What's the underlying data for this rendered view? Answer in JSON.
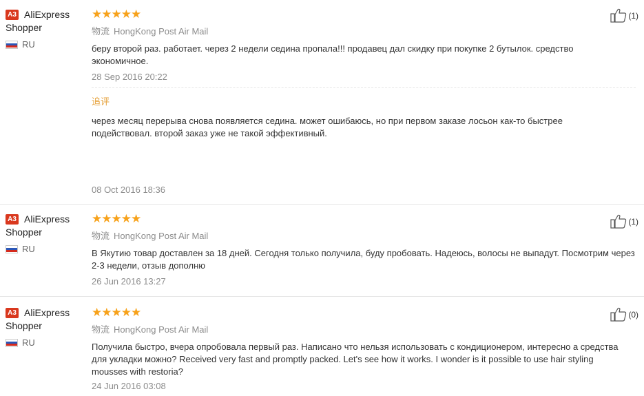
{
  "reviews": [
    {
      "badge": "A3",
      "user_line1": "AliExpress",
      "user_line2": "Shopper",
      "country": "RU",
      "stars": "★★★★★",
      "logistics_key": "物流",
      "logistics_value": "HongKong Post Air Mail",
      "feedback": "беру второй раз. работает. через 2 недели седина пропала!!! продавец дал скидку при покупке 2 бутылок. средство экономичное.",
      "date": "28 Sep 2016 20:22",
      "append_label": "追评",
      "append_feedback": "через месяц перерыва снова появляется седина. может ошибаюсь, но при первом заказе лосьон как-то быстрее подействовал. второй заказ уже не такой эффективный.",
      "append_date": "08 Oct 2016 18:36",
      "likes": "(1)"
    },
    {
      "badge": "A3",
      "user_line1": "AliExpress",
      "user_line2": "Shopper",
      "country": "RU",
      "stars": "★★★★★",
      "logistics_key": "物流",
      "logistics_value": "HongKong Post Air Mail",
      "feedback": "В Якутию товар доставлен за 18 дней. Сегодня только получила, буду пробовать. Надеюсь, волосы не выпадут. Посмотрим через 2-3 недели, отзыв дополню",
      "date": "26 Jun 2016 13:27",
      "likes": "(1)"
    },
    {
      "badge": "A3",
      "user_line1": "AliExpress",
      "user_line2": "Shopper",
      "country": "RU",
      "stars": "★★★★★",
      "logistics_key": "物流",
      "logistics_value": "HongKong Post Air Mail",
      "feedback": "Получила быстро, вчера опробовала первый раз. Написано что нельзя использовать с кондиционером, интересно а средства для укладки можно? Received very fast and promptly packed. Let's see how it works. I wonder is it possible to use hair styling mousses with restoria?",
      "date": "24 Jun 2016 03:08",
      "likes": "(0)"
    }
  ],
  "colors": {
    "star": "#f7a21b",
    "badge": "#d9381e",
    "append_label": "#e6a23c"
  },
  "icons": {
    "like": "thumbs-up-icon",
    "flag": "russia-flag-icon"
  }
}
